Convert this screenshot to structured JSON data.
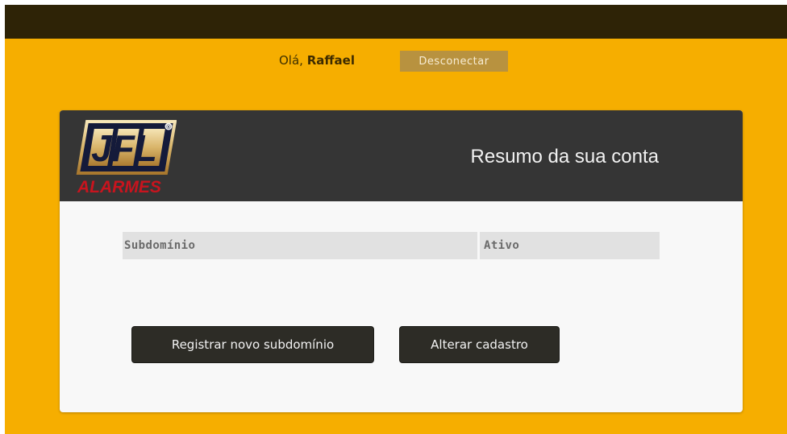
{
  "header": {
    "greeting_prefix": "Olá, ",
    "username": "Raffael",
    "logout_label": "Desconectar"
  },
  "card": {
    "logo": {
      "brand_text": "JFL",
      "sub_text": "ALARMES",
      "registered_mark": "®"
    },
    "title": "Resumo da sua conta",
    "table": {
      "columns": [
        "Subdomínio",
        "Ativo"
      ],
      "rows": []
    },
    "buttons": {
      "register_label": "Registrar novo subdomínio",
      "edit_label": "Alterar cadastro"
    }
  },
  "colors": {
    "page_background": "#f6ae00",
    "topbar": "#2e2306",
    "card_header": "#353535",
    "logout_button": "#b8923f",
    "action_button": "#2d2c26",
    "logo_red": "#c8141e"
  }
}
